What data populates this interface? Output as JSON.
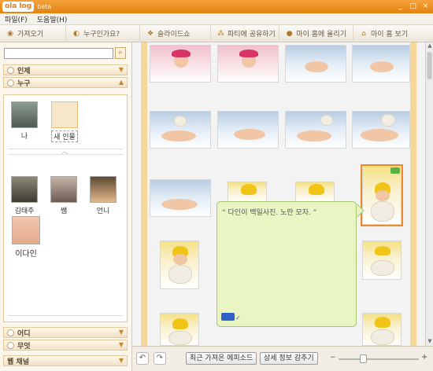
{
  "app": {
    "logo": "ola log",
    "edition": "beta"
  },
  "window_controls": {
    "minimize": "_",
    "maximize": "□",
    "close": "×"
  },
  "menu": [
    "파일(F)",
    "도움말(H)"
  ],
  "toolbar": {
    "import": "가져오기",
    "who": "누구인가요?",
    "slideshow": "슬라이드쇼",
    "share": "파티에 공유하기",
    "upload": "마이 홈에 올리기",
    "home": "마이 홈 보기"
  },
  "left": {
    "search_value": "",
    "search_icon": "magnifier-icon",
    "sections": {
      "person": "인제",
      "who": "누구",
      "where": "어디",
      "what": "무엇",
      "channel": "웹 채널"
    },
    "me": "나",
    "new_person": "새 인물",
    "people": [
      "김태주",
      "쌤",
      "언니",
      "이다인"
    ]
  },
  "note": {
    "text": "“ 다인이 백일사진. 노란 모자. ”"
  },
  "bottom": {
    "undo_icon": "rotate-left-icon",
    "redo_icon": "rotate-right-icon",
    "recent_label": "최근 가져온 에피소드",
    "details_label": "상세 정보 감추기",
    "zoom_minus": "−",
    "zoom_plus": "+",
    "zoom_level": 0.27
  },
  "colors": {
    "accent": "#e98b2a",
    "panel": "#fbf6ec",
    "note": "#e9f5c2"
  }
}
